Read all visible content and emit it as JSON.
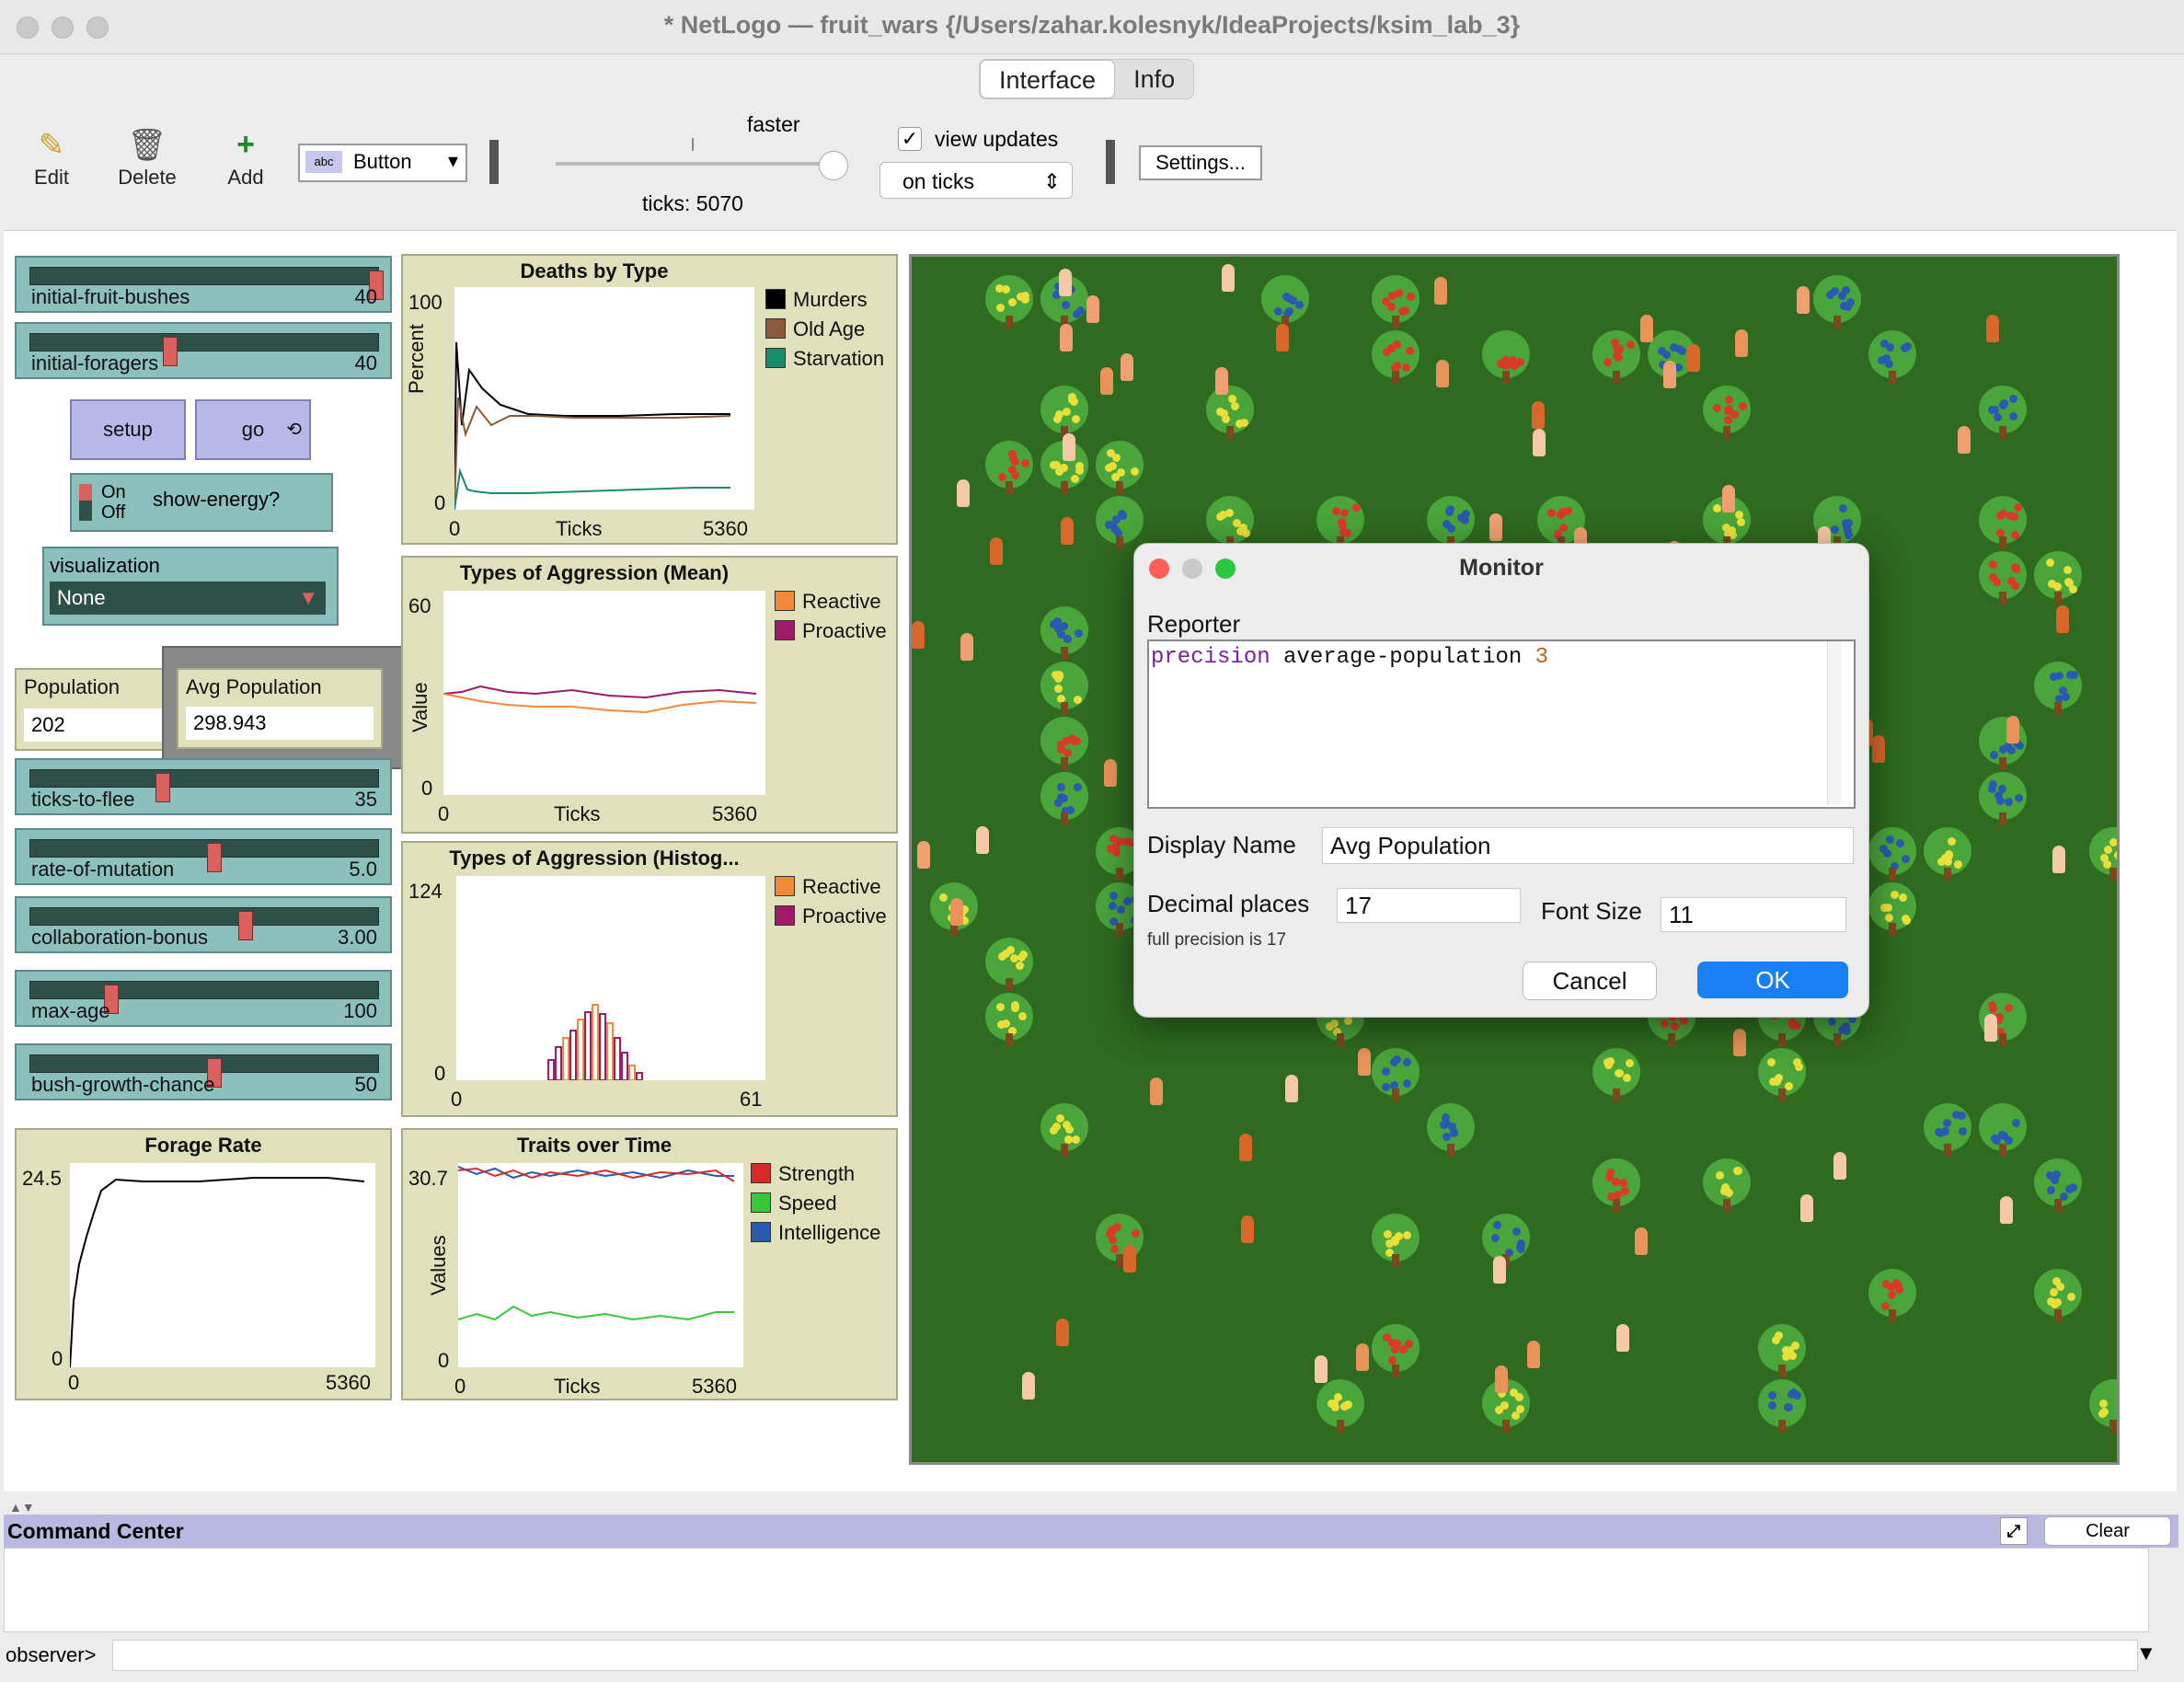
{
  "window": {
    "title": "* NetLogo — fruit_wars {/Users/zahar.kolesnyk/IdeaProjects/ksim_lab_3}"
  },
  "tabs": [
    {
      "label": "Interface"
    },
    {
      "label": "Info"
    }
  ],
  "toolbar": {
    "edit_label": "Edit",
    "delete_label": "Delete",
    "add_label": "Add",
    "widget_type": "Button",
    "speed_label": "faster",
    "ticks_label": "ticks: 5070",
    "view_updates_label": "view updates",
    "view_updates_checked": true,
    "update_mode": "on ticks",
    "settings_label": "Settings..."
  },
  "sliders": [
    {
      "label": "initial-fruit-bushes",
      "value": "40",
      "pos": 0.98
    },
    {
      "label": "initial-foragers",
      "value": "40",
      "pos": 0.38
    },
    {
      "label": "ticks-to-flee",
      "value": "35",
      "pos": 0.35
    },
    {
      "label": "rate-of-mutation",
      "value": "5.0",
      "pos": 0.5
    },
    {
      "label": "collaboration-bonus",
      "value": "3.00",
      "pos": 0.6
    },
    {
      "label": "max-age",
      "value": "100",
      "pos": 0.22
    },
    {
      "label": "bush-growth-chance",
      "value": "50",
      "pos": 0.5
    }
  ],
  "buttons": {
    "setup": "setup",
    "go": "go"
  },
  "switch": {
    "on": "On",
    "off": "Off",
    "label": "show-energy?"
  },
  "chooser": {
    "label": "visualization",
    "value": "None"
  },
  "monitors": [
    {
      "label": "Population",
      "value": "202"
    },
    {
      "label": "Avg Population",
      "value": "298.943"
    }
  ],
  "plots": {
    "deaths": {
      "title": "Deaths by Type",
      "ylabel": "Percent",
      "xlabel": "Ticks",
      "ymax": "100",
      "ymin": "0",
      "xmin": "0",
      "xmax": "5360",
      "legend": [
        {
          "name": "Murders",
          "color": "#000000"
        },
        {
          "name": "Old Age",
          "color": "#8a5a3a"
        },
        {
          "name": "Starvation",
          "color": "#1a8a6a"
        }
      ]
    },
    "agg_mean": {
      "title": "Types of Aggression (Mean)",
      "ylabel": "Value",
      "xlabel": "Ticks",
      "ymax": "60",
      "ymin": "0",
      "xmin": "0",
      "xmax": "5360",
      "legend": [
        {
          "name": "Reactive",
          "color": "#f08a3a"
        },
        {
          "name": "Proactive",
          "color": "#a01a6a"
        }
      ]
    },
    "agg_hist": {
      "title": "Types of Aggression (Histog...",
      "ymax": "124",
      "ymin": "0",
      "xmin": "0",
      "xmax": "61",
      "legend": [
        {
          "name": "Reactive",
          "color": "#f08a3a"
        },
        {
          "name": "Proactive",
          "color": "#a01a6a"
        }
      ]
    },
    "forage": {
      "title": "Forage Rate",
      "ymax": "24.5",
      "ymin": "0",
      "xmin": "0",
      "xmax": "5360"
    },
    "traits": {
      "title": "Traits over Time",
      "ylabel": "Values",
      "xlabel": "Ticks",
      "ymax": "30.7",
      "ymin": "0",
      "xmin": "0",
      "xmax": "5360",
      "legend": [
        {
          "name": "Strength",
          "color": "#d82a2a"
        },
        {
          "name": "Speed",
          "color": "#3ac83a"
        },
        {
          "name": "Intelligence",
          "color": "#2a5ab0"
        }
      ]
    }
  },
  "dialog": {
    "title": "Monitor",
    "reporter_label": "Reporter",
    "reporter_kw": "precision",
    "reporter_mid": " average-population ",
    "reporter_num": "3",
    "display_name_label": "Display Name",
    "display_name_value": "Avg Population",
    "decimal_label": "Decimal places",
    "decimal_value": "17",
    "font_size_label": "Font Size",
    "font_size_value": "11",
    "precision_note": "full precision is 17",
    "cancel_label": "Cancel",
    "ok_label": "OK"
  },
  "command_center": {
    "title": "Command Center",
    "clear_label": "Clear",
    "prompt": "observer>"
  }
}
